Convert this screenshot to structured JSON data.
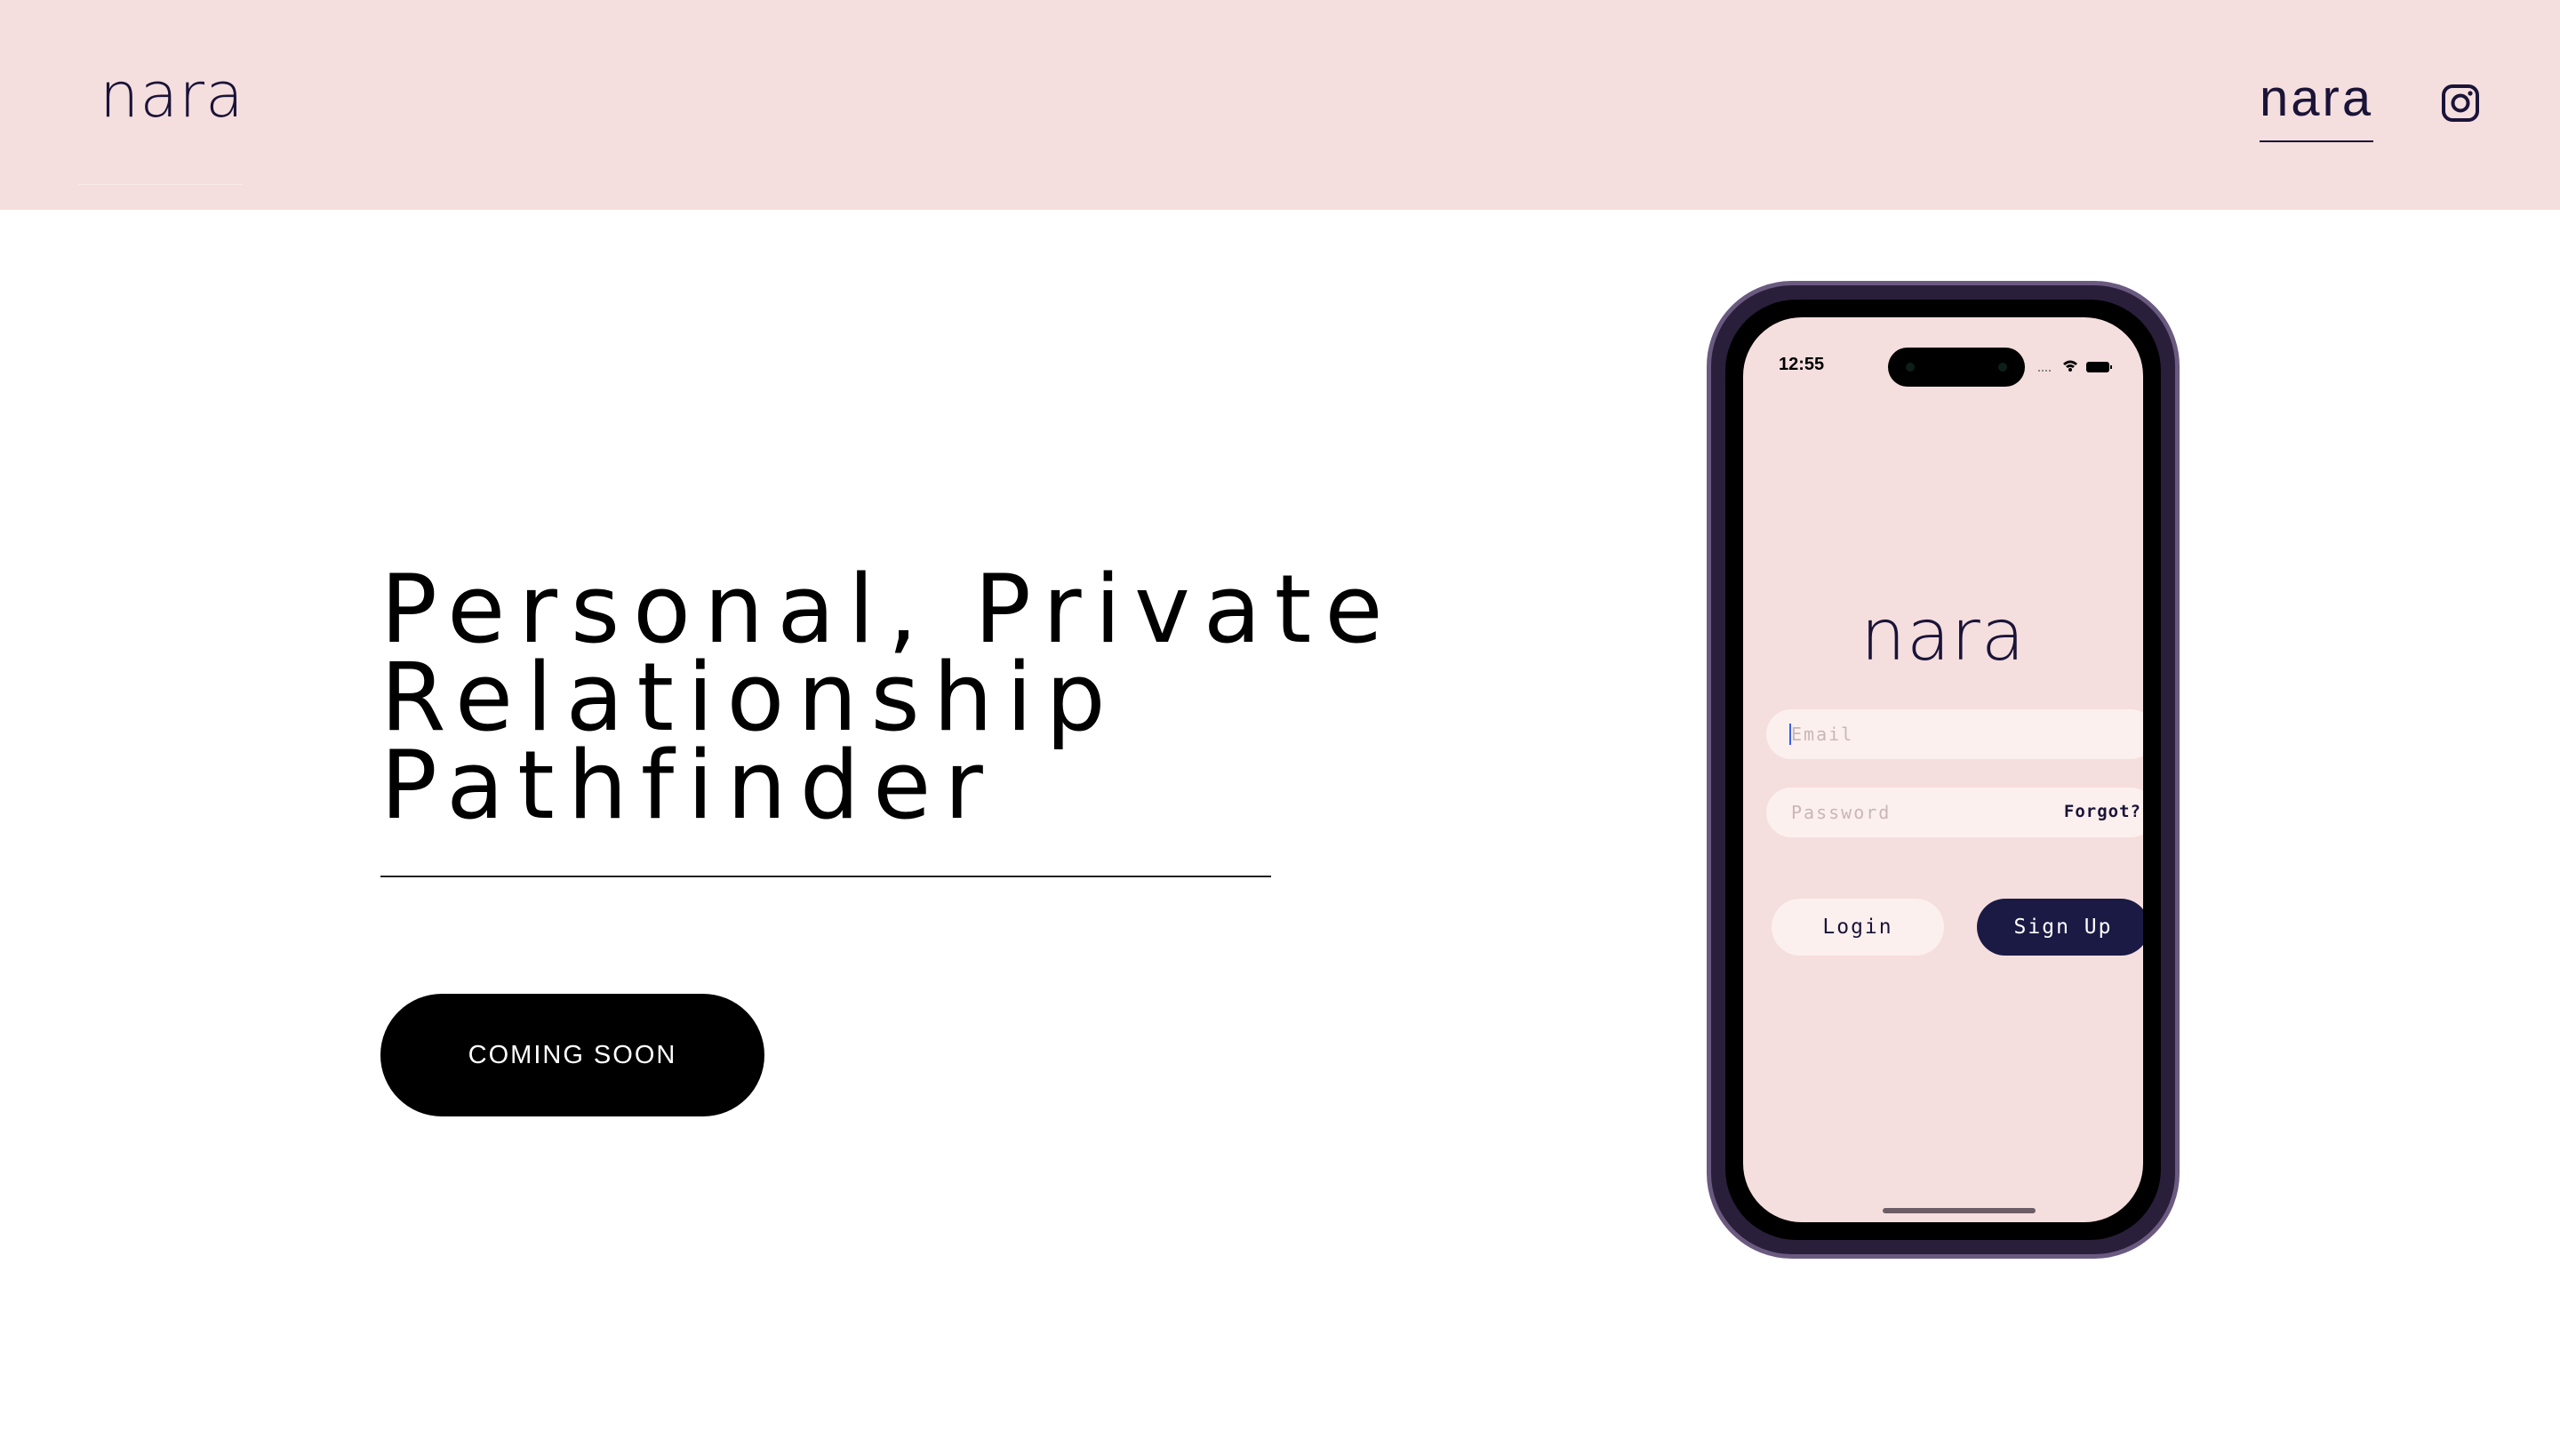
{
  "header": {
    "logo": "nara",
    "nav_link": "nara",
    "social_icon": "instagram-icon"
  },
  "hero": {
    "headline_lines": [
      "Personal, Private",
      "Relationship",
      "Pathfinder"
    ],
    "cta_label": "COMING SOON"
  },
  "phone": {
    "status_time": "12:55",
    "status_icons": [
      "signal-icon",
      "wifi-icon",
      "battery-icon"
    ],
    "app_logo": "nara",
    "email_placeholder": "Email",
    "password_placeholder": "Password",
    "forgot_label": "Forgot?",
    "login_label": "Login",
    "signup_label": "Sign Up"
  },
  "colors": {
    "header_bg": "#f5dede",
    "brand_navy": "#1a1438",
    "signup_bg": "#1a1a45",
    "input_bg": "#fcf0ee",
    "cta_bg": "#000000"
  }
}
